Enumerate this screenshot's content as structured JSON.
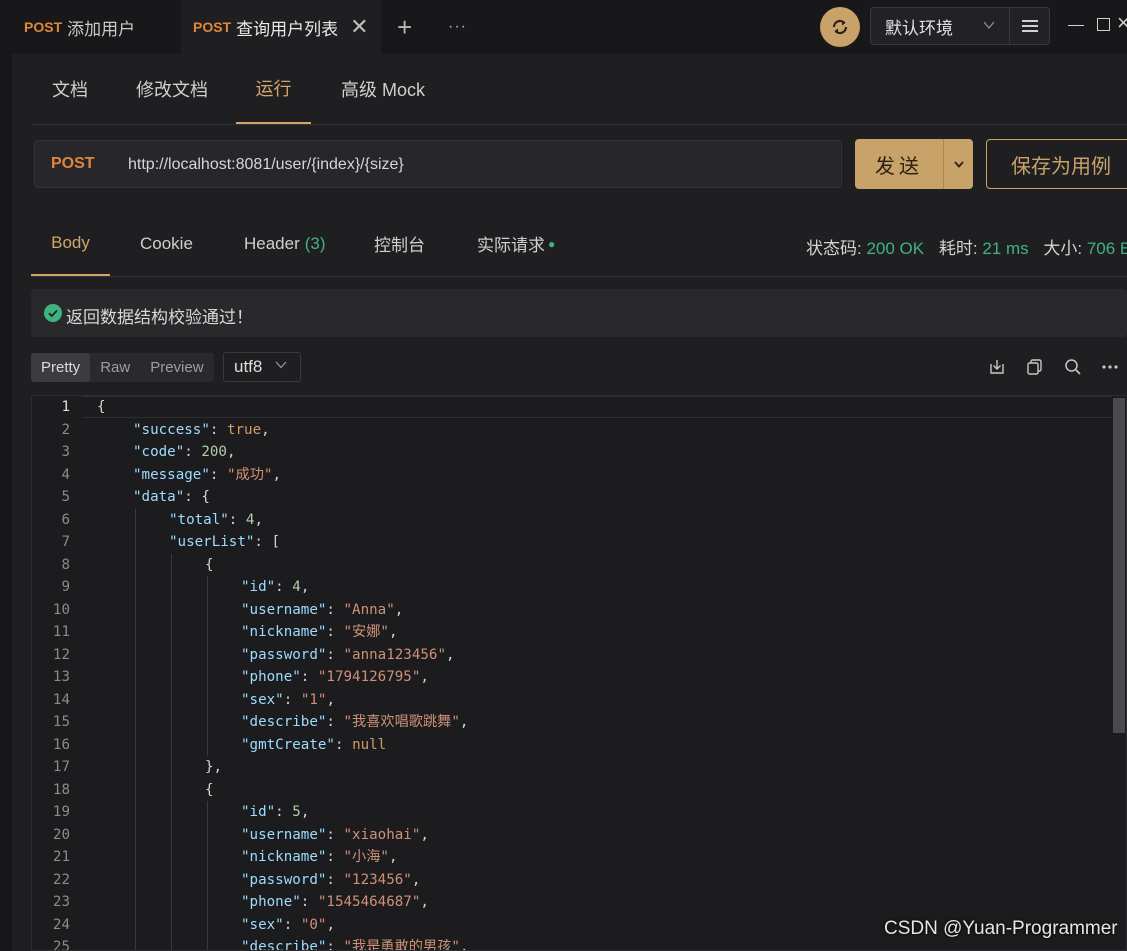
{
  "tabs": [
    {
      "method": "POST",
      "label": "添加用户"
    },
    {
      "method": "POST",
      "label": "查询用户列表"
    }
  ],
  "tab_close": "✕",
  "add_tab": "+",
  "more_tabs": "···",
  "environment": "默认环境",
  "sub_tabs": [
    "文档",
    "修改文档",
    "运行",
    "高级 Mock"
  ],
  "request": {
    "method": "POST",
    "url": "http://localhost:8081/user/{index}/{size}",
    "send_label": "发送",
    "save_label": "保存为用例"
  },
  "response_tabs": {
    "body": "Body",
    "cookie": "Cookie",
    "header": "Header",
    "header_count": "(3)",
    "console": "控制台",
    "actual": "实际请求"
  },
  "status": {
    "code_label": "状态码:",
    "code_value": "200 OK",
    "time_label": "耗时:",
    "time_value": "21 ms",
    "size_label": "大小:",
    "size_value": "706 B"
  },
  "validation_message": "返回数据结构校验通过！",
  "view_modes": [
    "Pretty",
    "Raw",
    "Preview"
  ],
  "encoding": "utf8",
  "code_lines": [
    {
      "n": "1",
      "indent": 0,
      "t": [
        [
          "p",
          "{"
        ]
      ]
    },
    {
      "n": "2",
      "indent": 1,
      "t": [
        [
          "k",
          "\"success\""
        ],
        [
          "p",
          ": "
        ],
        [
          "b",
          "true"
        ],
        [
          "p",
          ","
        ]
      ]
    },
    {
      "n": "3",
      "indent": 1,
      "t": [
        [
          "k",
          "\"code\""
        ],
        [
          "p",
          ": "
        ],
        [
          "n",
          "200"
        ],
        [
          "p",
          ","
        ]
      ]
    },
    {
      "n": "4",
      "indent": 1,
      "t": [
        [
          "k",
          "\"message\""
        ],
        [
          "p",
          ": "
        ],
        [
          "s",
          "\"成功\""
        ],
        [
          "p",
          ","
        ]
      ]
    },
    {
      "n": "5",
      "indent": 1,
      "t": [
        [
          "k",
          "\"data\""
        ],
        [
          "p",
          ": {"
        ]
      ]
    },
    {
      "n": "6",
      "indent": 2,
      "t": [
        [
          "k",
          "\"total\""
        ],
        [
          "p",
          ": "
        ],
        [
          "n",
          "4"
        ],
        [
          "p",
          ","
        ]
      ]
    },
    {
      "n": "7",
      "indent": 2,
      "t": [
        [
          "k",
          "\"userList\""
        ],
        [
          "p",
          ": ["
        ]
      ]
    },
    {
      "n": "8",
      "indent": 3,
      "t": [
        [
          "p",
          "{"
        ]
      ]
    },
    {
      "n": "9",
      "indent": 4,
      "t": [
        [
          "k",
          "\"id\""
        ],
        [
          "p",
          ": "
        ],
        [
          "n",
          "4"
        ],
        [
          "p",
          ","
        ]
      ]
    },
    {
      "n": "10",
      "indent": 4,
      "t": [
        [
          "k",
          "\"username\""
        ],
        [
          "p",
          ": "
        ],
        [
          "s",
          "\"Anna\""
        ],
        [
          "p",
          ","
        ]
      ]
    },
    {
      "n": "11",
      "indent": 4,
      "t": [
        [
          "k",
          "\"nickname\""
        ],
        [
          "p",
          ": "
        ],
        [
          "s",
          "\"安娜\""
        ],
        [
          "p",
          ","
        ]
      ]
    },
    {
      "n": "12",
      "indent": 4,
      "t": [
        [
          "k",
          "\"password\""
        ],
        [
          "p",
          ": "
        ],
        [
          "s",
          "\"anna123456\""
        ],
        [
          "p",
          ","
        ]
      ]
    },
    {
      "n": "13",
      "indent": 4,
      "t": [
        [
          "k",
          "\"phone\""
        ],
        [
          "p",
          ": "
        ],
        [
          "s",
          "\"1794126795\""
        ],
        [
          "p",
          ","
        ]
      ]
    },
    {
      "n": "14",
      "indent": 4,
      "t": [
        [
          "k",
          "\"sex\""
        ],
        [
          "p",
          ": "
        ],
        [
          "s",
          "\"1\""
        ],
        [
          "p",
          ","
        ]
      ]
    },
    {
      "n": "15",
      "indent": 4,
      "t": [
        [
          "k",
          "\"describe\""
        ],
        [
          "p",
          ": "
        ],
        [
          "s",
          "\"我喜欢唱歌跳舞\""
        ],
        [
          "p",
          ","
        ]
      ]
    },
    {
      "n": "16",
      "indent": 4,
      "t": [
        [
          "k",
          "\"gmtCreate\""
        ],
        [
          "p",
          ": "
        ],
        [
          "b",
          "null"
        ]
      ]
    },
    {
      "n": "17",
      "indent": 3,
      "t": [
        [
          "p",
          "},"
        ]
      ]
    },
    {
      "n": "18",
      "indent": 3,
      "t": [
        [
          "p",
          "{"
        ]
      ]
    },
    {
      "n": "19",
      "indent": 4,
      "t": [
        [
          "k",
          "\"id\""
        ],
        [
          "p",
          ": "
        ],
        [
          "n",
          "5"
        ],
        [
          "p",
          ","
        ]
      ]
    },
    {
      "n": "20",
      "indent": 4,
      "t": [
        [
          "k",
          "\"username\""
        ],
        [
          "p",
          ": "
        ],
        [
          "s",
          "\"xiaohai\""
        ],
        [
          "p",
          ","
        ]
      ]
    },
    {
      "n": "21",
      "indent": 4,
      "t": [
        [
          "k",
          "\"nickname\""
        ],
        [
          "p",
          ": "
        ],
        [
          "s",
          "\"小海\""
        ],
        [
          "p",
          ","
        ]
      ]
    },
    {
      "n": "22",
      "indent": 4,
      "t": [
        [
          "k",
          "\"password\""
        ],
        [
          "p",
          ": "
        ],
        [
          "s",
          "\"123456\""
        ],
        [
          "p",
          ","
        ]
      ]
    },
    {
      "n": "23",
      "indent": 4,
      "t": [
        [
          "k",
          "\"phone\""
        ],
        [
          "p",
          ": "
        ],
        [
          "s",
          "\"1545464687\""
        ],
        [
          "p",
          ","
        ]
      ]
    },
    {
      "n": "24",
      "indent": 4,
      "t": [
        [
          "k",
          "\"sex\""
        ],
        [
          "p",
          ": "
        ],
        [
          "s",
          "\"0\""
        ],
        [
          "p",
          ","
        ]
      ]
    },
    {
      "n": "25",
      "indent": 4,
      "t": [
        [
          "k",
          "\"describe\""
        ],
        [
          "p",
          ": "
        ],
        [
          "s",
          "\"我是勇敢的男孩\""
        ],
        [
          "p",
          ","
        ]
      ]
    }
  ],
  "watermark": "CSDN @Yuan-Programmer",
  "colors": {
    "accent": "#c9a269",
    "method": "#e0873c",
    "success": "#3fb37f"
  },
  "icons": [
    "sync-icon",
    "chevron-down-icon",
    "menu-icon",
    "check-circle-icon",
    "download-icon",
    "copy-icon",
    "search-icon",
    "more-icon"
  ]
}
